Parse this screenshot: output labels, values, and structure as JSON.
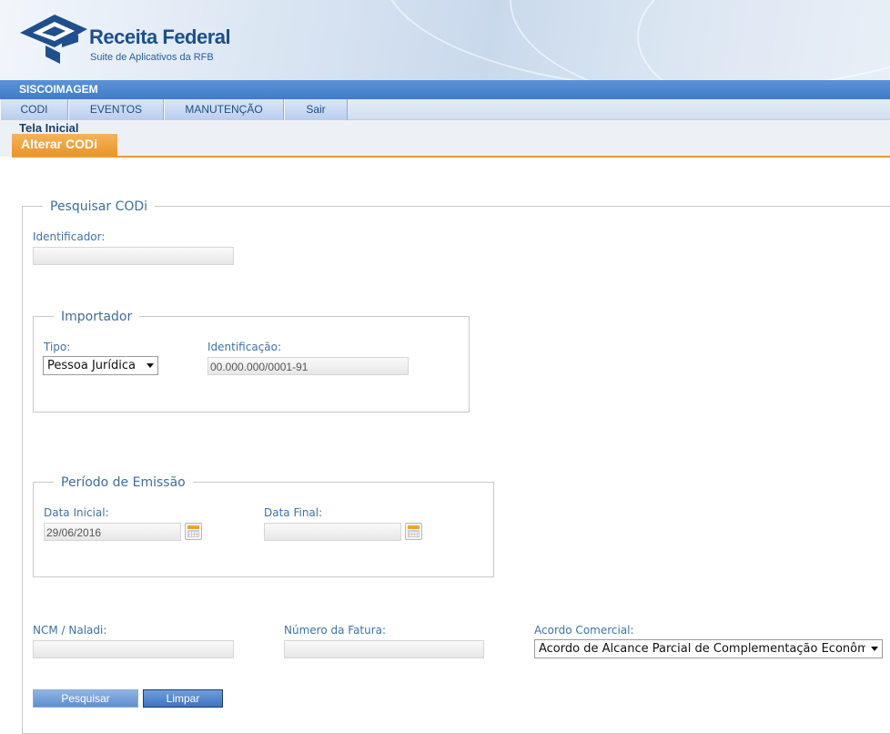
{
  "brand": {
    "title": "Receita Federal",
    "subtitle": "Suite de Aplicativos da RFB"
  },
  "system": {
    "name": "SISCOIMAGEM"
  },
  "menu": {
    "items": [
      "CODI",
      "EVENTOS",
      "MANUTENÇÃO",
      "Sair"
    ]
  },
  "breadcrumb": "Tela Inicial",
  "tab": {
    "label": "Alterar CODi"
  },
  "search": {
    "legend": "Pesquisar CODi",
    "identificador_label": "Identificador:",
    "identificador_value": "",
    "importador": {
      "legend": "Importador",
      "tipo_label": "Tipo:",
      "tipo_value": "Pessoa Jurídica",
      "identificacao_label": "Identificação:",
      "identificacao_value": "00.000.000/0001-91"
    },
    "periodo": {
      "legend": "Período de Emissão",
      "data_inicial_label": "Data Inicial:",
      "data_inicial_value": "29/06/2016",
      "data_final_label": "Data Final:",
      "data_final_value": ""
    },
    "ncm_label": "NCM / Naladi:",
    "ncm_value": "",
    "fatura_label": "Número da Fatura:",
    "fatura_value": "",
    "acordo_label": "Acordo Comercial:",
    "acordo_value": "Acordo de Alcance Parcial de Complementação Econômica",
    "buttons": {
      "pesquisar": "Pesquisar",
      "limpar": "Limpar"
    }
  },
  "colors": {
    "accent_orange": "#e9952a",
    "bar_blue": "#3f7cc8",
    "label_blue": "#3e72a8"
  }
}
